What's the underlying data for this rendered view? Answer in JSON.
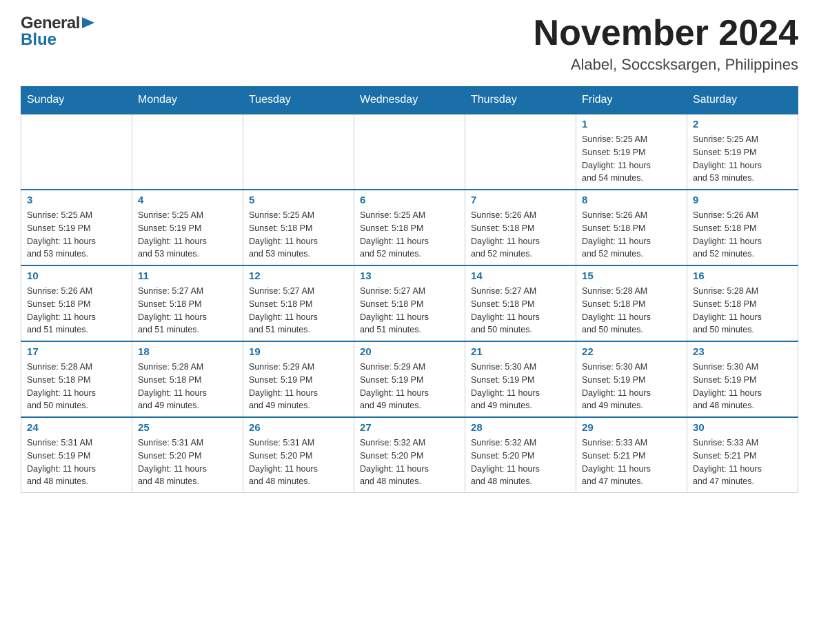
{
  "header": {
    "title": "November 2024",
    "subtitle": "Alabel, Soccsksargen, Philippines",
    "logo_general": "General",
    "logo_blue": "Blue"
  },
  "weekdays": [
    "Sunday",
    "Monday",
    "Tuesday",
    "Wednesday",
    "Thursday",
    "Friday",
    "Saturday"
  ],
  "weeks": [
    {
      "days": [
        {
          "num": "",
          "info": ""
        },
        {
          "num": "",
          "info": ""
        },
        {
          "num": "",
          "info": ""
        },
        {
          "num": "",
          "info": ""
        },
        {
          "num": "",
          "info": ""
        },
        {
          "num": "1",
          "info": "Sunrise: 5:25 AM\nSunset: 5:19 PM\nDaylight: 11 hours\nand 54 minutes."
        },
        {
          "num": "2",
          "info": "Sunrise: 5:25 AM\nSunset: 5:19 PM\nDaylight: 11 hours\nand 53 minutes."
        }
      ]
    },
    {
      "days": [
        {
          "num": "3",
          "info": "Sunrise: 5:25 AM\nSunset: 5:19 PM\nDaylight: 11 hours\nand 53 minutes."
        },
        {
          "num": "4",
          "info": "Sunrise: 5:25 AM\nSunset: 5:19 PM\nDaylight: 11 hours\nand 53 minutes."
        },
        {
          "num": "5",
          "info": "Sunrise: 5:25 AM\nSunset: 5:18 PM\nDaylight: 11 hours\nand 53 minutes."
        },
        {
          "num": "6",
          "info": "Sunrise: 5:25 AM\nSunset: 5:18 PM\nDaylight: 11 hours\nand 52 minutes."
        },
        {
          "num": "7",
          "info": "Sunrise: 5:26 AM\nSunset: 5:18 PM\nDaylight: 11 hours\nand 52 minutes."
        },
        {
          "num": "8",
          "info": "Sunrise: 5:26 AM\nSunset: 5:18 PM\nDaylight: 11 hours\nand 52 minutes."
        },
        {
          "num": "9",
          "info": "Sunrise: 5:26 AM\nSunset: 5:18 PM\nDaylight: 11 hours\nand 52 minutes."
        }
      ]
    },
    {
      "days": [
        {
          "num": "10",
          "info": "Sunrise: 5:26 AM\nSunset: 5:18 PM\nDaylight: 11 hours\nand 51 minutes."
        },
        {
          "num": "11",
          "info": "Sunrise: 5:27 AM\nSunset: 5:18 PM\nDaylight: 11 hours\nand 51 minutes."
        },
        {
          "num": "12",
          "info": "Sunrise: 5:27 AM\nSunset: 5:18 PM\nDaylight: 11 hours\nand 51 minutes."
        },
        {
          "num": "13",
          "info": "Sunrise: 5:27 AM\nSunset: 5:18 PM\nDaylight: 11 hours\nand 51 minutes."
        },
        {
          "num": "14",
          "info": "Sunrise: 5:27 AM\nSunset: 5:18 PM\nDaylight: 11 hours\nand 50 minutes."
        },
        {
          "num": "15",
          "info": "Sunrise: 5:28 AM\nSunset: 5:18 PM\nDaylight: 11 hours\nand 50 minutes."
        },
        {
          "num": "16",
          "info": "Sunrise: 5:28 AM\nSunset: 5:18 PM\nDaylight: 11 hours\nand 50 minutes."
        }
      ]
    },
    {
      "days": [
        {
          "num": "17",
          "info": "Sunrise: 5:28 AM\nSunset: 5:18 PM\nDaylight: 11 hours\nand 50 minutes."
        },
        {
          "num": "18",
          "info": "Sunrise: 5:28 AM\nSunset: 5:18 PM\nDaylight: 11 hours\nand 49 minutes."
        },
        {
          "num": "19",
          "info": "Sunrise: 5:29 AM\nSunset: 5:19 PM\nDaylight: 11 hours\nand 49 minutes."
        },
        {
          "num": "20",
          "info": "Sunrise: 5:29 AM\nSunset: 5:19 PM\nDaylight: 11 hours\nand 49 minutes."
        },
        {
          "num": "21",
          "info": "Sunrise: 5:30 AM\nSunset: 5:19 PM\nDaylight: 11 hours\nand 49 minutes."
        },
        {
          "num": "22",
          "info": "Sunrise: 5:30 AM\nSunset: 5:19 PM\nDaylight: 11 hours\nand 49 minutes."
        },
        {
          "num": "23",
          "info": "Sunrise: 5:30 AM\nSunset: 5:19 PM\nDaylight: 11 hours\nand 48 minutes."
        }
      ]
    },
    {
      "days": [
        {
          "num": "24",
          "info": "Sunrise: 5:31 AM\nSunset: 5:19 PM\nDaylight: 11 hours\nand 48 minutes."
        },
        {
          "num": "25",
          "info": "Sunrise: 5:31 AM\nSunset: 5:20 PM\nDaylight: 11 hours\nand 48 minutes."
        },
        {
          "num": "26",
          "info": "Sunrise: 5:31 AM\nSunset: 5:20 PM\nDaylight: 11 hours\nand 48 minutes."
        },
        {
          "num": "27",
          "info": "Sunrise: 5:32 AM\nSunset: 5:20 PM\nDaylight: 11 hours\nand 48 minutes."
        },
        {
          "num": "28",
          "info": "Sunrise: 5:32 AM\nSunset: 5:20 PM\nDaylight: 11 hours\nand 48 minutes."
        },
        {
          "num": "29",
          "info": "Sunrise: 5:33 AM\nSunset: 5:21 PM\nDaylight: 11 hours\nand 47 minutes."
        },
        {
          "num": "30",
          "info": "Sunrise: 5:33 AM\nSunset: 5:21 PM\nDaylight: 11 hours\nand 47 minutes."
        }
      ]
    }
  ]
}
